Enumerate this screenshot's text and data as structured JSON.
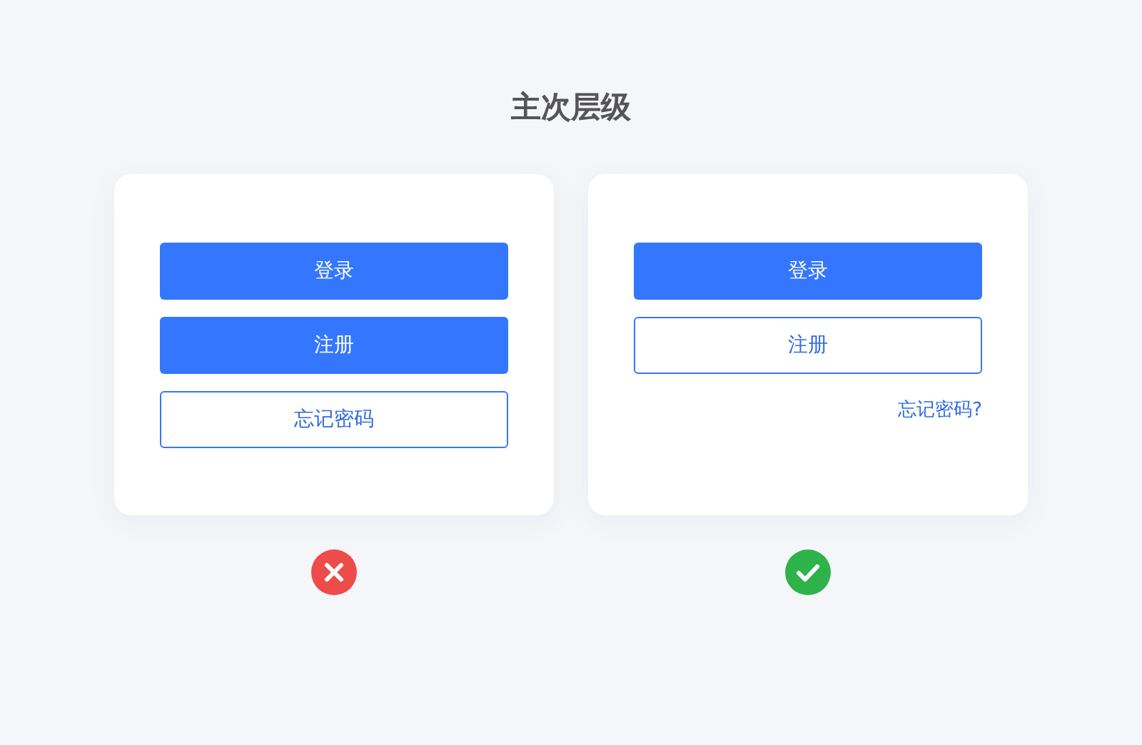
{
  "title": "主次层级",
  "examples": [
    {
      "correct": false,
      "buttons": [
        {
          "label": "登录",
          "kind": "primary"
        },
        {
          "label": "注册",
          "kind": "primary"
        },
        {
          "label": "忘记密码",
          "kind": "outline"
        }
      ]
    },
    {
      "correct": true,
      "buttons": [
        {
          "label": "登录",
          "kind": "primary"
        },
        {
          "label": "注册",
          "kind": "outline"
        },
        {
          "label": "忘记密码?",
          "kind": "link"
        }
      ]
    }
  ]
}
